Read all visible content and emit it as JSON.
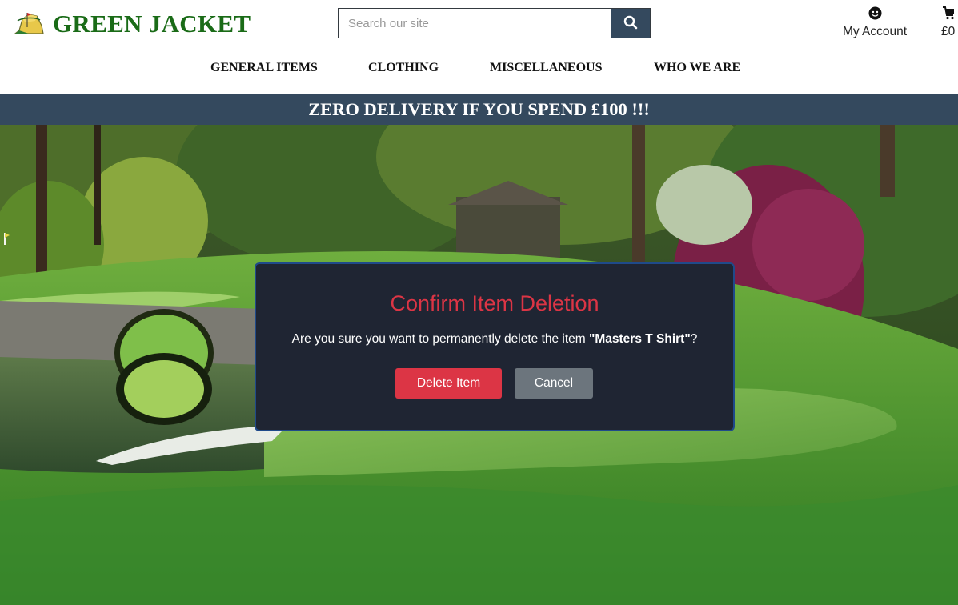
{
  "brand": {
    "name": "GREEN JACKET",
    "logo_icon": "masters-logo-icon"
  },
  "search": {
    "placeholder": "Search our site",
    "value": "",
    "icon": "search-icon"
  },
  "account": {
    "label": "My Account",
    "icon": "user-icon"
  },
  "bag": {
    "total": "£0",
    "icon": "shopping-bag-icon"
  },
  "nav": {
    "items": [
      {
        "label": "GENERAL ITEMS"
      },
      {
        "label": "CLOTHING"
      },
      {
        "label": "MISCELLANEOUS"
      },
      {
        "label": "WHO WE ARE"
      }
    ]
  },
  "banner": {
    "text": "ZERO DELIVERY IF YOU SPEND £100 !!!"
  },
  "modal": {
    "title": "Confirm Item Deletion",
    "message_prefix": "Are you sure you want to permanently delete the item ",
    "item_name": "\"Masters T Shirt\"",
    "message_suffix": "?",
    "delete_label": "Delete Item",
    "cancel_label": "Cancel"
  },
  "colors": {
    "brand_green": "#1a6b17",
    "banner_bg": "#34495e",
    "danger": "#dc3545",
    "secondary": "#6c757d",
    "modal_bg": "#1f2533"
  }
}
